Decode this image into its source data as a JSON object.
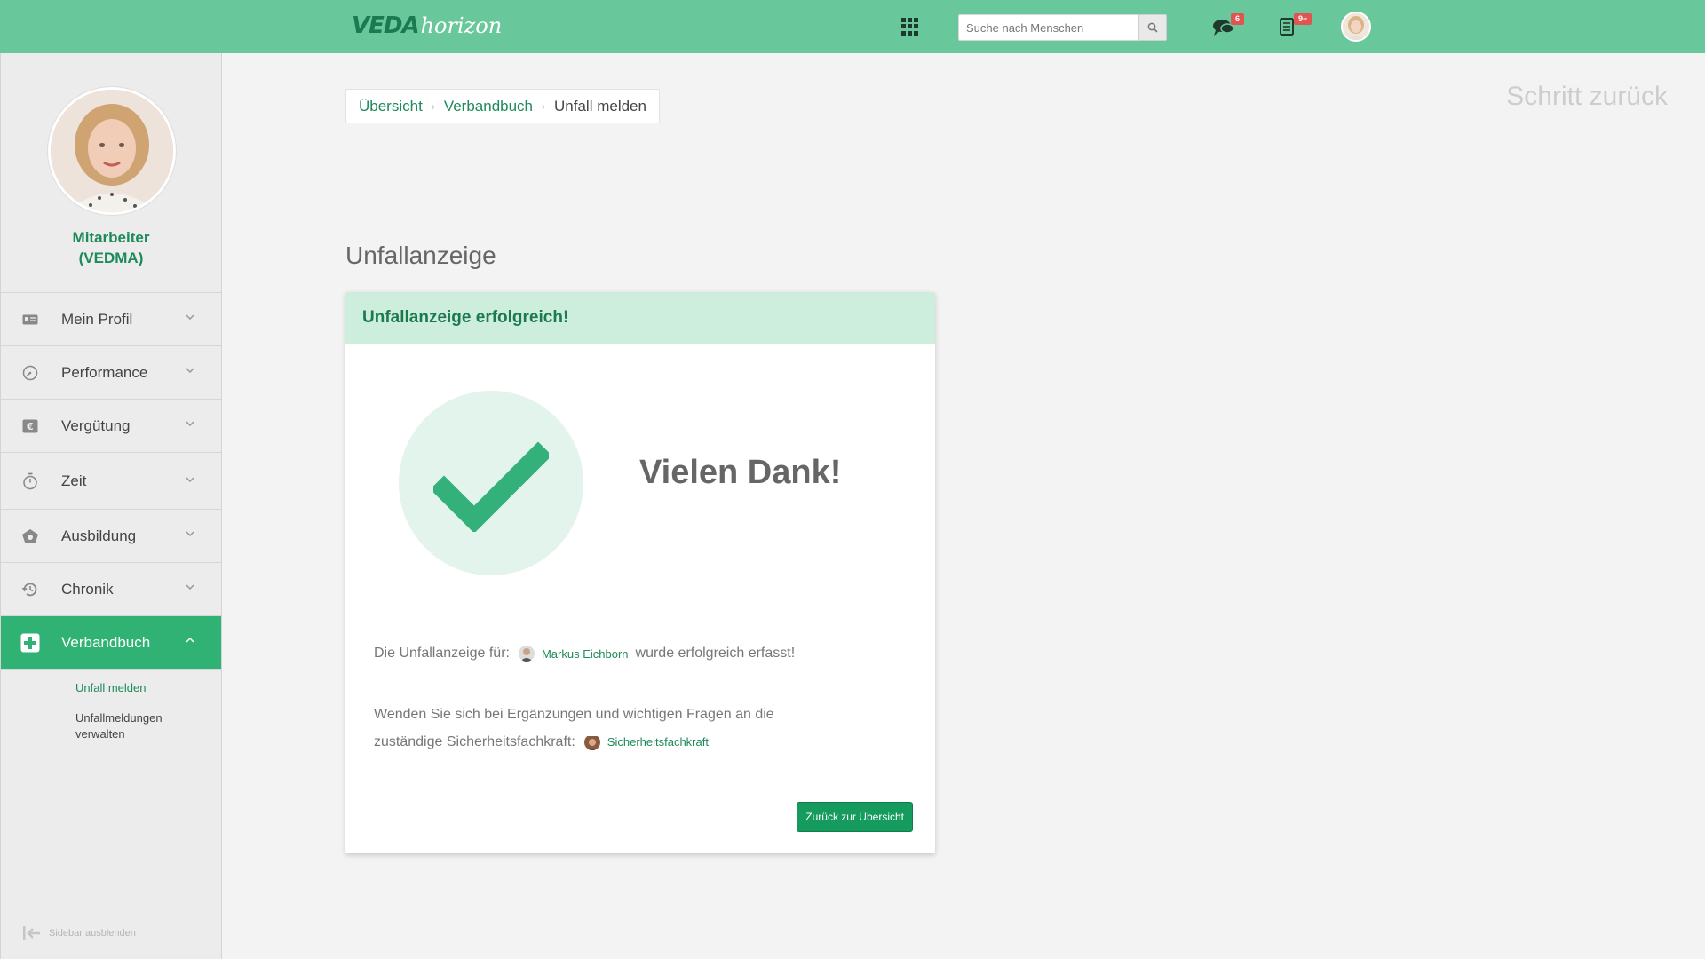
{
  "header": {
    "logo_primary": "VEDA",
    "logo_secondary": "horizon",
    "search_placeholder": "Suche nach Menschen",
    "messages_badge": "6",
    "tasks_badge": "9+"
  },
  "sidebar": {
    "role_line1": "Mitarbeiter",
    "role_line2": "(VEDMA)",
    "items": [
      {
        "label": "Mein Profil",
        "icon": "id-card-icon"
      },
      {
        "label": "Performance",
        "icon": "gauge-icon"
      },
      {
        "label": "Vergütung",
        "icon": "euro-icon"
      },
      {
        "label": "Zeit",
        "icon": "stopwatch-icon"
      },
      {
        "label": "Ausbildung",
        "icon": "graduation-icon"
      },
      {
        "label": "Chronik",
        "icon": "history-icon"
      },
      {
        "label": "Verbandbuch",
        "icon": "first-aid-icon"
      }
    ],
    "subitems": [
      {
        "label": "Unfall melden"
      },
      {
        "label": "Unfallmeldungen verwalten"
      }
    ],
    "hide_label": "Sidebar ausblenden"
  },
  "breadcrumb": {
    "items": [
      "Übersicht",
      "Verbandbuch"
    ],
    "current": "Unfall melden"
  },
  "step_back": "Schritt zurück",
  "page_title": "Unfallanzeige",
  "card": {
    "header": "Unfallanzeige erfolgreich!",
    "thanks": "Vielen Dank!",
    "line1_prefix": "Die Unfallanzeige für:",
    "line1_person": "Markus Eichborn",
    "line1_suffix": "wurde erfolgreich erfasst!",
    "line2_part1": "Wenden Sie sich bei Ergänzungen und wichtigen Fragen an die",
    "line2_part2": "zuständige Sicherheitsfachkraft:",
    "line2_person": "Sicherheitsfachkraft",
    "button_label": "Zurück zur Übersicht"
  },
  "colors": {
    "topbar": "#69c89b",
    "accent": "#1d8a5a",
    "active_menu": "#2fb273",
    "badge": "#e25451"
  }
}
